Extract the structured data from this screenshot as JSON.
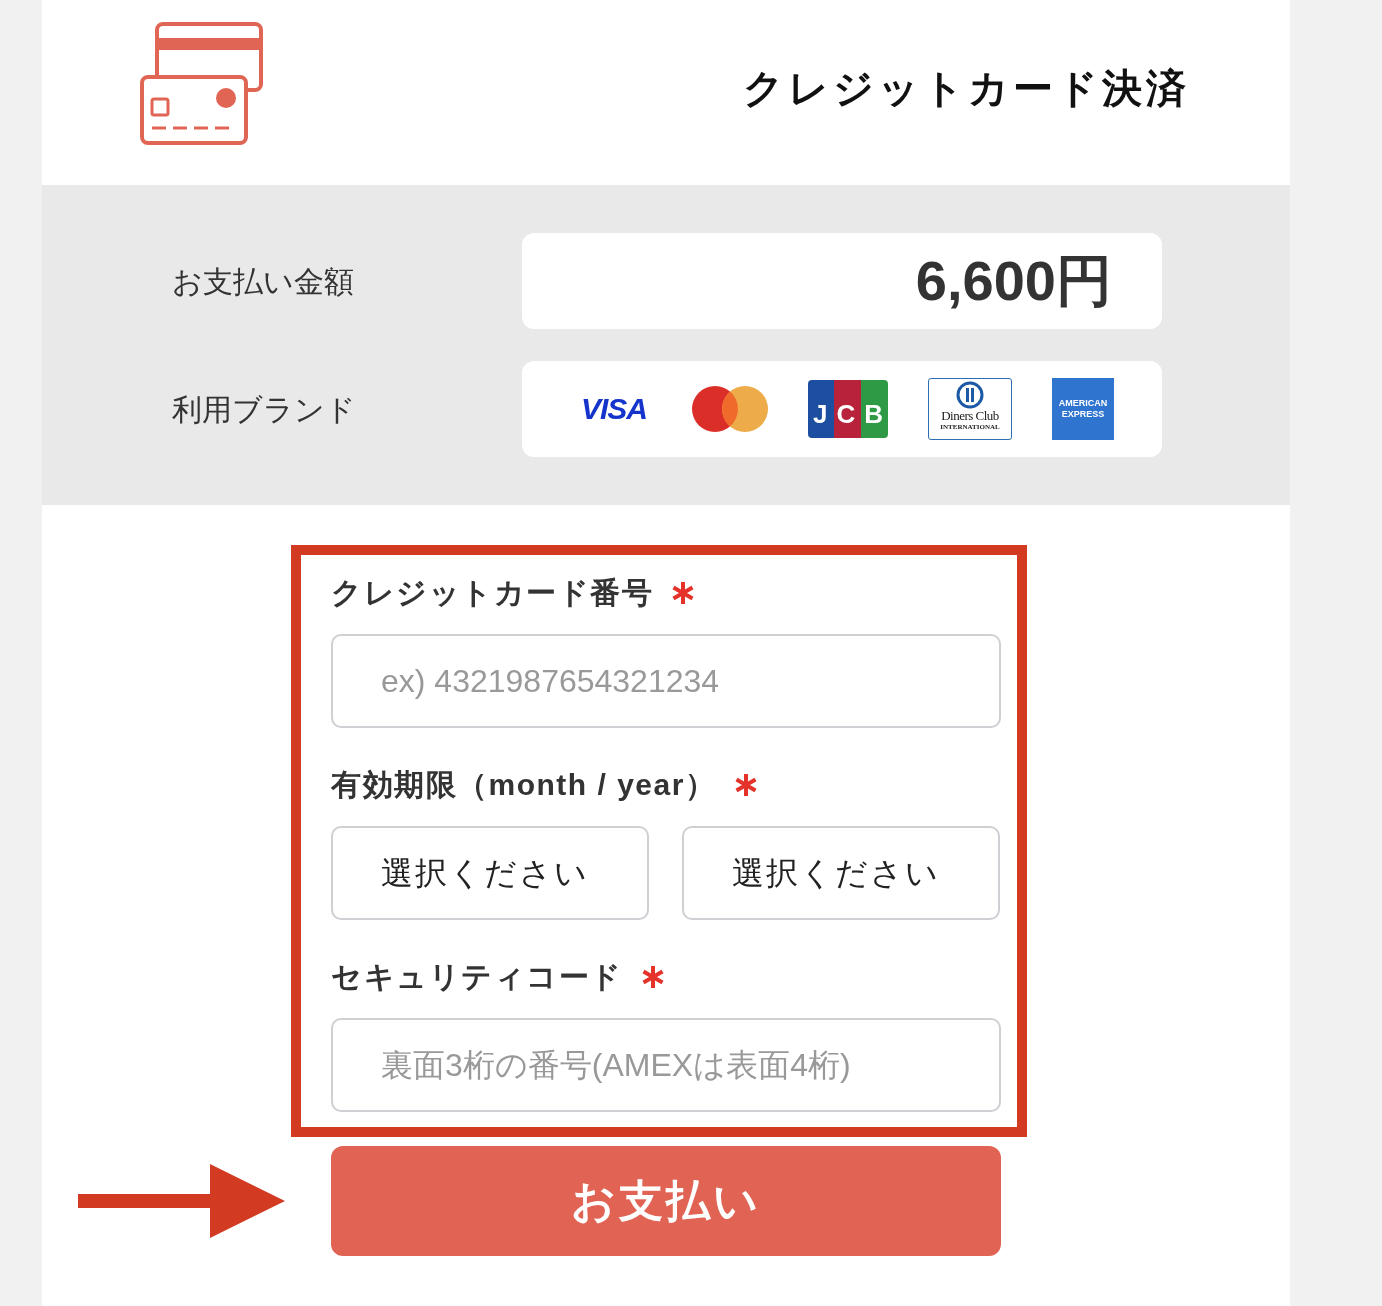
{
  "header": {
    "title": "クレジットカード決済"
  },
  "summary": {
    "amount": {
      "label": "お支払い金額",
      "value": "6,600円"
    },
    "brands": {
      "label": "利用ブランド",
      "items": [
        {
          "kind": "visa",
          "label": "VISA"
        },
        {
          "kind": "mastercard"
        },
        {
          "kind": "jcb",
          "label": "JCB"
        },
        {
          "kind": "diners",
          "label": "Diners Club",
          "sublabel": "INTERNATIONAL"
        },
        {
          "kind": "amex",
          "label": "AMERICAN",
          "sublabel": "EXPRESS"
        }
      ]
    }
  },
  "form": {
    "fields": [
      {
        "kind": "text",
        "label": "クレジットカード番号",
        "required": true,
        "placeholder": "ex) 4321987654321234"
      },
      {
        "kind": "selects",
        "label": "有効期限（month / year）",
        "required": true,
        "selects": [
          {
            "value": "選択ください"
          },
          {
            "value": "選択ください"
          }
        ]
      },
      {
        "kind": "text",
        "label": "セキュリティコード",
        "required": true,
        "placeholder": "裏面3桁の番号(AMEXは表面4桁)"
      }
    ]
  },
  "submit": {
    "label": "お支払い"
  }
}
